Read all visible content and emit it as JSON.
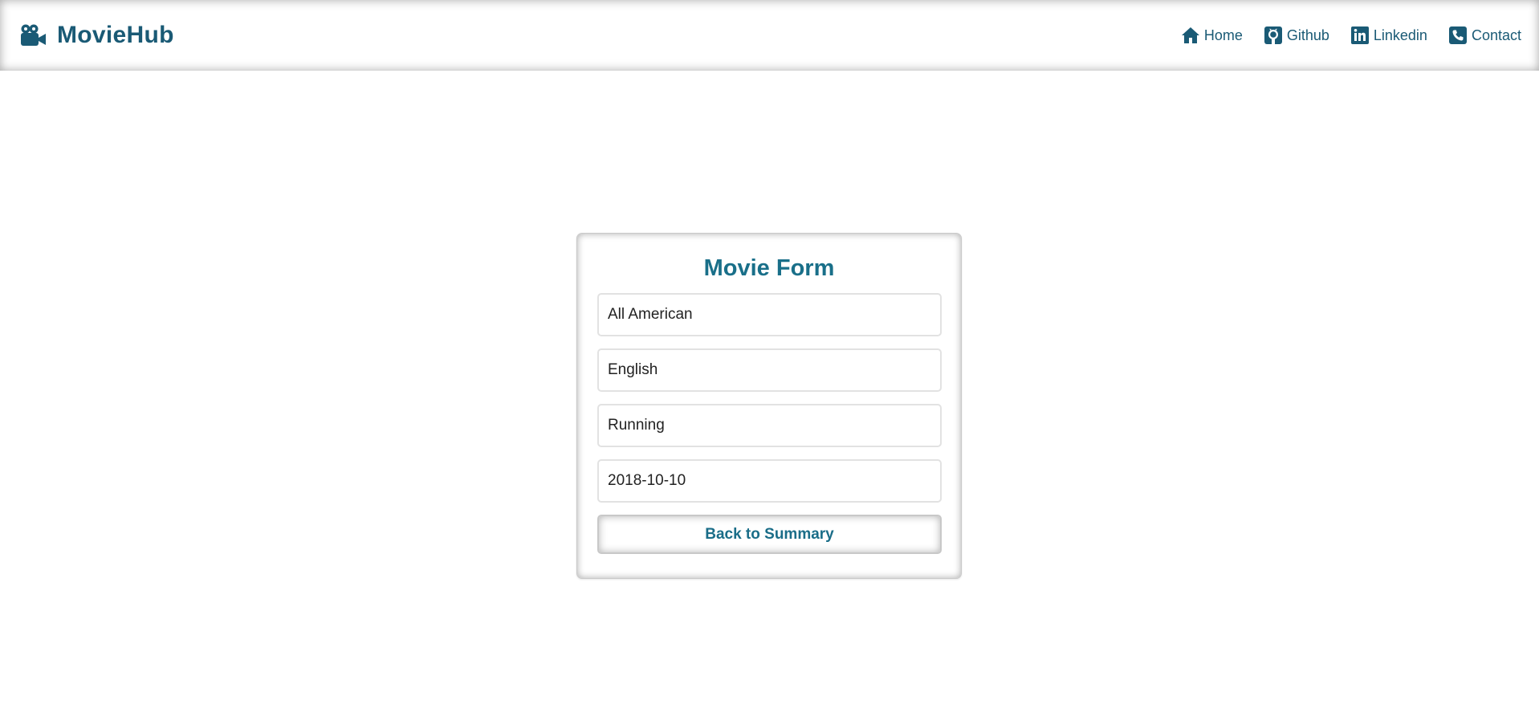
{
  "brand": {
    "title": "MovieHub",
    "icon": "video-camera-icon"
  },
  "nav": {
    "items": [
      {
        "label": "Home",
        "icon": "home-icon"
      },
      {
        "label": "Github",
        "icon": "github-icon"
      },
      {
        "label": "Linkedin",
        "icon": "linkedin-icon"
      },
      {
        "label": "Contact",
        "icon": "phone-icon"
      }
    ]
  },
  "form": {
    "title": "Movie Form",
    "fields": [
      {
        "value": "All American"
      },
      {
        "value": "English"
      },
      {
        "value": "Running"
      },
      {
        "value": "2018-10-10"
      }
    ],
    "back_label": "Back to Summary"
  },
  "colors": {
    "brand": "#1a5a75",
    "accent": "#196f89"
  }
}
